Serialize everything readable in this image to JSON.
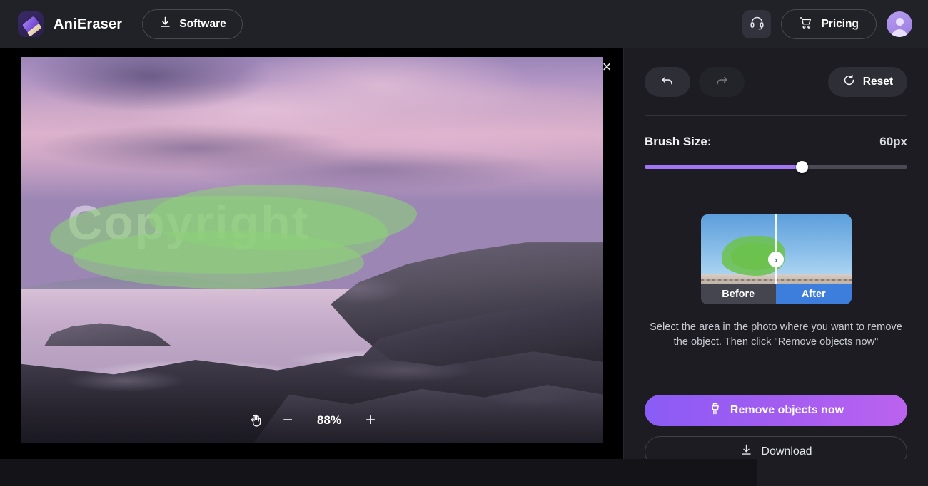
{
  "header": {
    "brand_name": "AniEraser",
    "logo_icon": "eraser-icon",
    "software_label": "Software",
    "software_icon": "download-icon",
    "support_icon": "headset-icon",
    "pricing_label": "Pricing",
    "pricing_icon": "cart-icon",
    "avatar_icon": "user-avatar"
  },
  "canvas": {
    "close_label": "×",
    "watermark_text": "Copyright",
    "pan_icon": "hand-icon",
    "zoom_out_label": "−",
    "zoom_level": "88%",
    "zoom_in_label": "+"
  },
  "panel": {
    "undo_icon": "undo-icon",
    "redo_icon": "redo-icon",
    "reset_label": "Reset",
    "reset_icon": "refresh-icon",
    "brush": {
      "label": "Brush Size:",
      "value": "60px",
      "percent": 60
    },
    "preview": {
      "before_label": "Before",
      "after_label": "After",
      "handle_icon": "chevron-right-icon"
    },
    "hint_text": "Select the area in the photo where you want to remove the object. Then click \"Remove objects now\"",
    "remove_label": "Remove objects now",
    "remove_icon": "brush-clean-icon",
    "download_label": "Download",
    "download_icon": "download-icon"
  },
  "colors": {
    "accent_purple": "#a275f5",
    "remove_gradient_start": "#8a5cf6",
    "remove_gradient_end": "#bb63ef",
    "after_blue": "#3d7ddb",
    "mask_green": "#8ed07a",
    "panel_bg": "#1c1c22",
    "header_bg": "#212128"
  }
}
